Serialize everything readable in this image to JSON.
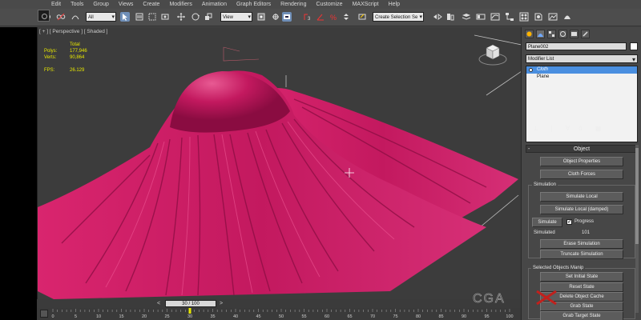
{
  "menu": [
    "Edit",
    "Tools",
    "Group",
    "Views",
    "Create",
    "Modifiers",
    "Animation",
    "Graph Editors",
    "Rendering",
    "Customize",
    "MAXScript",
    "Help"
  ],
  "toolbar": {
    "filter_value": "All",
    "coord_value": "View",
    "selection_set_placeholder": "Create Selection Se"
  },
  "viewport": {
    "label": "[ + ] [ Perspective ] [ Shaded ]",
    "stats": {
      "header": "Total",
      "polys_label": "Polys:",
      "polys_value": "177,946",
      "verts_label": "Verts:",
      "verts_value": "90,864",
      "fps_label": "FPS:",
      "fps_value": "26.129"
    },
    "cloth_color": "#c3195f"
  },
  "command_panel": {
    "object_name": "Plane002",
    "modifier_list": "Modifier List",
    "stack": [
      "Cloth",
      "Plane"
    ],
    "rollout_title": "Object",
    "buttons": {
      "object_properties": "Object Properties",
      "cloth_forces": "Cloth Forces",
      "simulate_local": "Simulate Local",
      "simulate_local_damped": "Simulate Local (damped)",
      "simulate": "Simulate",
      "erase_simulation": "Erase Simulation",
      "truncate_simulation": "Truncate Simulation",
      "set_initial_state": "Set Initial State",
      "reset_state": "Reset State",
      "delete_cache": "Delete Object Cache",
      "grab_state": "Grab State",
      "grab_target_state": "Grab Target State"
    },
    "simulation_group": "Simulation",
    "progress_label": "Progress",
    "simulated_label": "Simulated",
    "simulated_value": "101",
    "manip_group": "Selected Objects Manip"
  },
  "timeline": {
    "slider_text": "30 / 100",
    "ticks": [
      "0",
      "5",
      "10",
      "15",
      "20",
      "25",
      "30",
      "35",
      "40",
      "45",
      "50",
      "55",
      "60",
      "65",
      "70",
      "75",
      "80",
      "85",
      "90",
      "95",
      "100"
    ],
    "current_frame": 30,
    "total_frames": 100
  }
}
